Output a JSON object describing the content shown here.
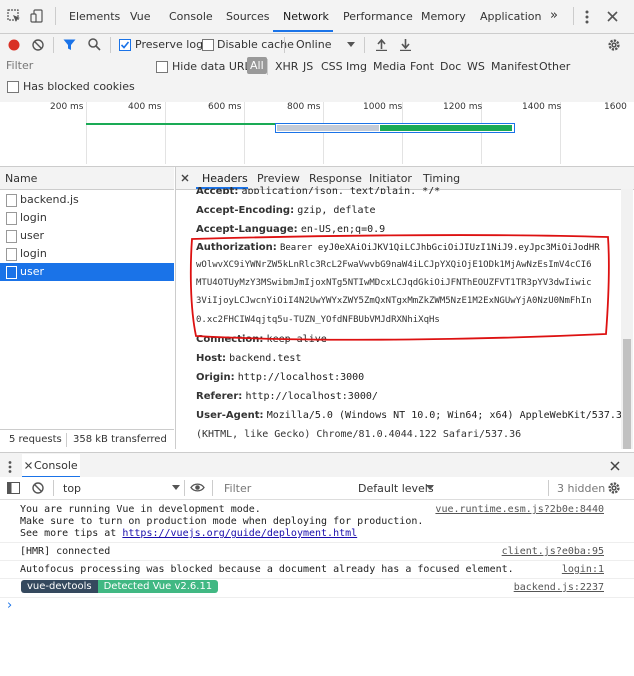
{
  "tabs": [
    "Elements",
    "Vue",
    "Console",
    "Sources",
    "Network",
    "Performance",
    "Memory",
    "Application"
  ],
  "tabs_more": "»",
  "toolbar": {
    "preserve_log": "Preserve log",
    "disable_cache": "Disable cache",
    "throttle": "Online"
  },
  "filter": {
    "placeholder": "Filter",
    "hide_data_urls": "Hide data URLs",
    "types": [
      "All",
      "XHR",
      "JS",
      "CSS",
      "Img",
      "Media",
      "Font",
      "Doc",
      "WS",
      "Manifest",
      "Other"
    ],
    "has_blocked_cookies": "Has blocked cookies"
  },
  "timeline": {
    "ticks": [
      "200 ms",
      "400 ms",
      "600 ms",
      "800 ms",
      "1000 ms",
      "1200 ms",
      "1400 ms",
      "1600"
    ]
  },
  "requests": {
    "header": "Name",
    "items": [
      "backend.js",
      "login",
      "user",
      "login",
      "user"
    ],
    "selected_index": 4,
    "summary_requests": "5 requests",
    "summary_transferred": "358 kB transferred"
  },
  "details": {
    "tabs": [
      "Headers",
      "Preview",
      "Response",
      "Initiator",
      "Timing"
    ],
    "rows": [
      {
        "k": "Accept:",
        "v": "application/json, text/plain, */*"
      },
      {
        "k": "Accept-Encoding:",
        "v": "gzip, deflate"
      },
      {
        "k": "Accept-Language:",
        "v": "en-US,en;q=0.9"
      },
      {
        "k": "Authorization:",
        "v": "Bearer eyJ0eXAiOiJKV1QiLCJhbGciOiJIUzI1NiJ9.eyJpc3MiOiJodHR"
      },
      {
        "k": "",
        "v": "wOlwvXC9iYWNrZW5kLnRlc3RcL2FwaVwvbG9naW4iLCJpYXQiOjE1ODk1MjAwNzEsImV4cCI6"
      },
      {
        "k": "",
        "v": "MTU4OTUyMzY3MSwibmJmIjoxNTg5NTIwMDcxLCJqdGkiOiJFNThEOUZFVT1TR3pYV3dwIiwic"
      },
      {
        "k": "",
        "v": "3ViIjoyLCJwcnYiOiI4N2UwYWYxZWY5ZmQxNTgxMmZkZWM5NzE1M2ExNGUwYjA0NzU0NmFhIn"
      },
      {
        "k": "",
        "v": "0.xc2FHCIW4qjtq5u-TUZN_YOfdNFBUbVMJdRXNhiXqHs"
      },
      {
        "k": "Connection:",
        "v": "keep-alive"
      },
      {
        "k": "Host:",
        "v": "backend.test"
      },
      {
        "k": "Origin:",
        "v": "http://localhost:3000"
      },
      {
        "k": "Referer:",
        "v": "http://localhost:3000/"
      },
      {
        "k": "User-Agent:",
        "v": "Mozilla/5.0 (Windows NT 10.0; Win64; x64) AppleWebKit/537.36"
      },
      {
        "k": "",
        "v": "(KHTML, like Gecko) Chrome/81.0.4044.122 Safari/537.36"
      }
    ]
  },
  "console": {
    "title": "Console",
    "context": "top",
    "filter_placeholder": "Filter",
    "levels": "Default levels",
    "hidden": "3 hidden",
    "messages": [
      {
        "text": "You are running Vue in development mode.",
        "src": "vue.runtime.esm.js?2b0e:8440"
      },
      {
        "text": "Make sure to turn on production mode when deploying for production.",
        "src": ""
      },
      {
        "text": "See more tips at ",
        "link": "https://vuejs.org/guide/deployment.html",
        "src": ""
      },
      {
        "text": "[HMR] connected",
        "src": "client.js?e0ba:95"
      },
      {
        "text": "Autofocus processing was blocked because a document already has a focused element.",
        "src": "login:1"
      },
      {
        "badge1": "vue-devtools",
        "badge2": "Detected Vue v2.6.11",
        "src": "backend.js:2237"
      }
    ],
    "prompt": "›"
  },
  "colors": {
    "accent": "#1a73e8",
    "annotation": "#d11",
    "badge_dark": "#35495e",
    "badge_green": "#41b883"
  }
}
